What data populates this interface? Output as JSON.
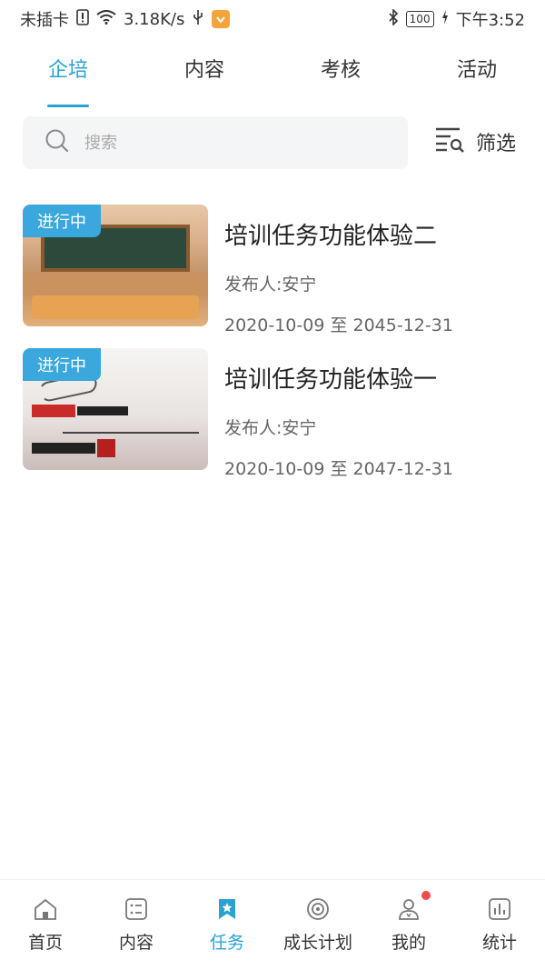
{
  "statusbar": {
    "carrier": "未插卡",
    "speed": "3.18K/s",
    "battery": "100",
    "time": "下午3:52"
  },
  "tabs": [
    {
      "label": "企培"
    },
    {
      "label": "内容"
    },
    {
      "label": "考核"
    },
    {
      "label": "活动"
    }
  ],
  "search": {
    "placeholder": "搜索",
    "value": ""
  },
  "filter": {
    "label": "筛选"
  },
  "tasks": [
    {
      "badge": "进行中",
      "title": "培训任务功能体验二",
      "publisher": "发布人:安宁",
      "date": "2020-10-09 至 2045-12-31"
    },
    {
      "badge": "进行中",
      "title": "培训任务功能体验一",
      "publisher": "发布人:安宁",
      "date": "2020-10-09 至 2047-12-31"
    }
  ],
  "bottom_nav": [
    {
      "label": "首页",
      "icon": "home-icon"
    },
    {
      "label": "内容",
      "icon": "content-icon"
    },
    {
      "label": "任务",
      "icon": "task-icon"
    },
    {
      "label": "成长计划",
      "icon": "target-icon"
    },
    {
      "label": "我的",
      "icon": "profile-icon"
    },
    {
      "label": "统计",
      "icon": "stats-icon"
    }
  ],
  "colors": {
    "accent": "#2aa1d3",
    "badge": "#3aa7dd",
    "notification_dot": "#f04a4a"
  }
}
